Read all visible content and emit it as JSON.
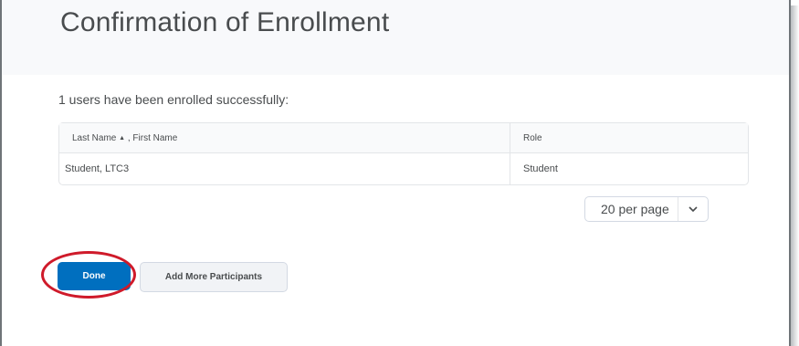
{
  "page": {
    "title": "Confirmation of Enrollment",
    "status_message": "1 users have been enrolled successfully:"
  },
  "table": {
    "columns": {
      "name_sort": "Last Name",
      "sort_icon": "▲",
      "name_rest": ", First Name",
      "role": "Role"
    },
    "rows": [
      {
        "name": "Student, LTC3",
        "role": "Student"
      }
    ]
  },
  "pager": {
    "selected": "20 per page",
    "chevron_icon": "chevron-down-icon"
  },
  "actions": {
    "done_label": "Done",
    "add_label": "Add More Participants"
  },
  "colors": {
    "primary": "#006fbf",
    "highlight": "#cf1a2a",
    "text": "#494c4e"
  }
}
